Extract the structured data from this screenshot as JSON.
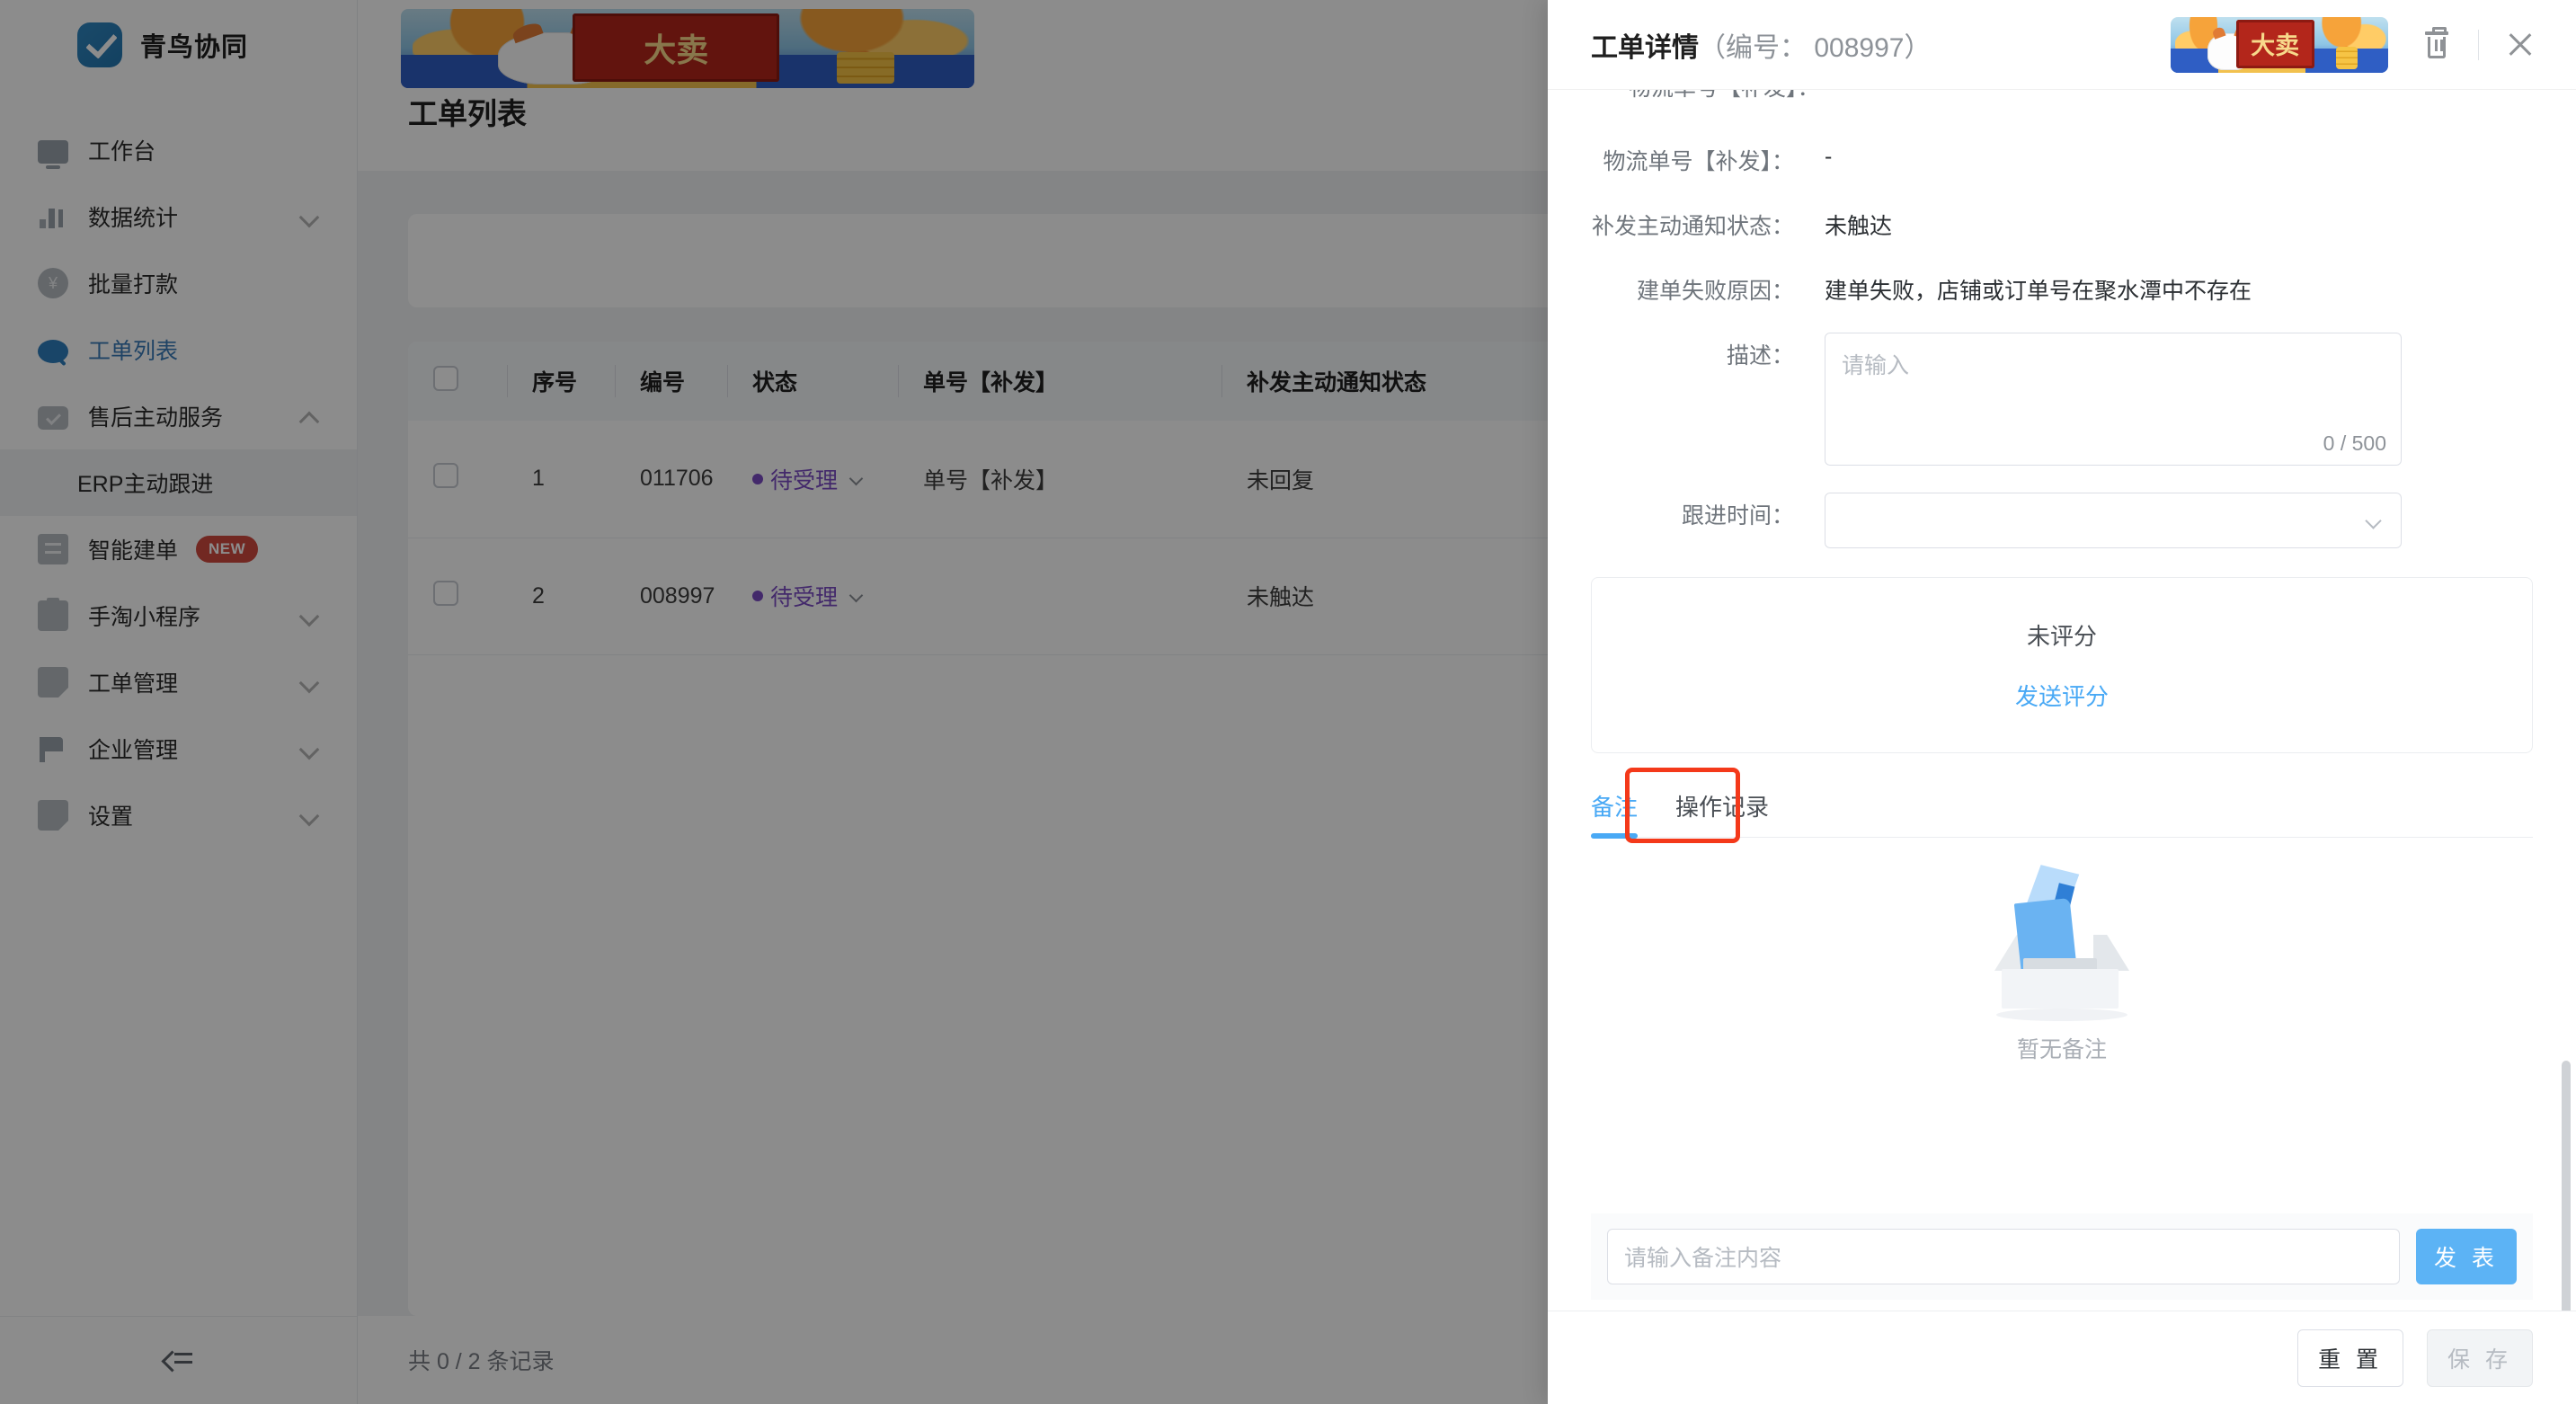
{
  "app": {
    "brand_name": "青鸟协同",
    "logo_icon": "checkmark-logo"
  },
  "sidebar": {
    "items": [
      {
        "label": "工作台",
        "icon": "monitor-icon",
        "chevron": "",
        "active": false
      },
      {
        "label": "数据统计",
        "icon": "bar-chart-icon",
        "chevron": "down",
        "active": false
      },
      {
        "label": "批量打款",
        "icon": "yen-circle-icon",
        "chevron": "",
        "active": false
      },
      {
        "label": "工单列表",
        "icon": "search-icon",
        "chevron": "",
        "active": true
      },
      {
        "label": "售后主动服务",
        "icon": "chat-check-icon",
        "chevron": "up",
        "active": false
      },
      {
        "label": "智能建单",
        "icon": "list-icon",
        "chevron": "",
        "badge": "NEW",
        "active": false
      },
      {
        "label": "手淘小程序",
        "icon": "clipboard-icon",
        "chevron": "down",
        "active": false
      },
      {
        "label": "工单管理",
        "icon": "document-icon",
        "chevron": "down",
        "active": false
      },
      {
        "label": "企业管理",
        "icon": "flag-icon",
        "chevron": "down",
        "active": false
      },
      {
        "label": "设置",
        "icon": "document-icon",
        "chevron": "down",
        "active": false
      }
    ],
    "submenu": {
      "label": "ERP主动跟进",
      "parent": "售后主动服务"
    },
    "collapse_icon": "collapse-sidebar-icon"
  },
  "main": {
    "page_title": "工单列表",
    "banner_alt": "大卖",
    "table": {
      "columns": [
        "序号",
        "编号",
        "状态",
        "单号【补发】",
        "补发主动通知状态"
      ],
      "rows": [
        {
          "seq": "1",
          "code": "011706",
          "status": "待受理",
          "order_no": "单号【补发】",
          "notify": "未回复"
        },
        {
          "seq": "2",
          "code": "008997",
          "status": "待受理",
          "order_no": "",
          "notify": "未触达"
        }
      ]
    },
    "footer_text": "共 0 / 2 条记录"
  },
  "drawer": {
    "title": "工单详情",
    "title_sub": "（编号： 008997）",
    "banner_alt": "大卖",
    "delete_icon": "trash-icon",
    "close_icon": "close-icon",
    "clipped_row": "物流单号【补发】：",
    "fields": [
      {
        "label": "物流单号【补发】：",
        "value": "-"
      },
      {
        "label": "补发主动通知状态：",
        "value": "未触达"
      },
      {
        "label": "建单失败原因：",
        "value": "建单失败，店铺或订单号在聚水潭中不存在"
      }
    ],
    "description": {
      "label": "描述：",
      "placeholder": "请输入",
      "counter": "0 / 500"
    },
    "follow_time": {
      "label": "跟进时间：",
      "value": ""
    },
    "rating": {
      "status": "未评分",
      "action": "发送评分"
    },
    "tabs": [
      {
        "label": "备注",
        "active": true,
        "highlighted": false
      },
      {
        "label": "操作记录",
        "active": false,
        "highlighted": true
      }
    ],
    "empty": {
      "caption": "暂无备注",
      "illustration": "empty-box-icon"
    },
    "comment": {
      "placeholder": "请输入备注内容",
      "post_label": "发 表"
    },
    "footer": {
      "reset_label": "重 置",
      "save_label": "保 存",
      "save_disabled": true
    }
  },
  "colors": {
    "accent_blue": "#49a9f5",
    "brand_blue": "#2f7fbd",
    "status_purple": "#7b4bc4",
    "highlight_red": "#f4391a",
    "badge_red": "#d04a3e"
  }
}
